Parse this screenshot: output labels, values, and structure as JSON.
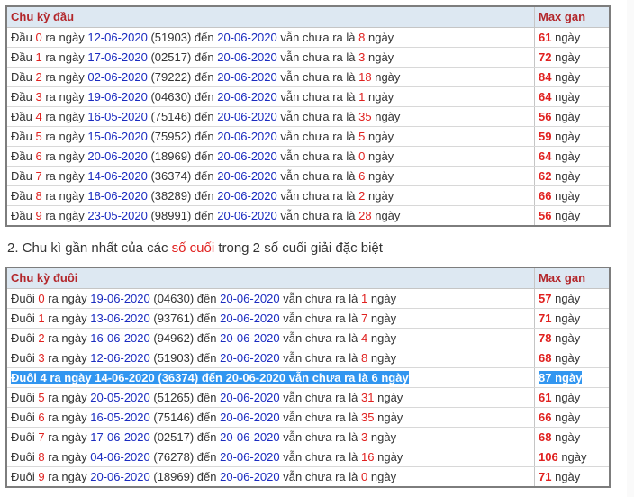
{
  "table1": {
    "col1_header": "Chu kỳ đầu",
    "col2_header": "Max gan",
    "prefix": "Đầu",
    "rows": [
      {
        "digit": "0",
        "date": "12-06-2020",
        "code": "(51903)",
        "to": "20-06-2020",
        "days": "8",
        "max": "61"
      },
      {
        "digit": "1",
        "date": "17-06-2020",
        "code": "(02517)",
        "to": "20-06-2020",
        "days": "3",
        "max": "72"
      },
      {
        "digit": "2",
        "date": "02-06-2020",
        "code": "(79222)",
        "to": "20-06-2020",
        "days": "18",
        "max": "84"
      },
      {
        "digit": "3",
        "date": "19-06-2020",
        "code": "(04630)",
        "to": "20-06-2020",
        "days": "1",
        "max": "64"
      },
      {
        "digit": "4",
        "date": "16-05-2020",
        "code": "(75146)",
        "to": "20-06-2020",
        "days": "35",
        "max": "56"
      },
      {
        "digit": "5",
        "date": "15-06-2020",
        "code": "(75952)",
        "to": "20-06-2020",
        "days": "5",
        "max": "59"
      },
      {
        "digit": "6",
        "date": "20-06-2020",
        "code": "(18969)",
        "to": "20-06-2020",
        "days": "0",
        "max": "64"
      },
      {
        "digit": "7",
        "date": "14-06-2020",
        "code": "(36374)",
        "to": "20-06-2020",
        "days": "6",
        "max": "62"
      },
      {
        "digit": "8",
        "date": "18-06-2020",
        "code": "(38289)",
        "to": "20-06-2020",
        "days": "2",
        "max": "66"
      },
      {
        "digit": "9",
        "date": "23-05-2020",
        "code": "(98991)",
        "to": "20-06-2020",
        "days": "28",
        "max": "56"
      }
    ]
  },
  "heading": {
    "before": "2. Chu kì gần nhất của các ",
    "highlight": "số cuối",
    "after": " trong 2 số cuối giải đặc biệt"
  },
  "table2": {
    "col1_header": "Chu kỳ đuôi",
    "col2_header": "Max gan",
    "prefix": "Đuôi",
    "selected_index": 4,
    "rows": [
      {
        "digit": "0",
        "date": "19-06-2020",
        "code": "(04630)",
        "to": "20-06-2020",
        "days": "1",
        "max": "57"
      },
      {
        "digit": "1",
        "date": "13-06-2020",
        "code": "(93761)",
        "to": "20-06-2020",
        "days": "7",
        "max": "71"
      },
      {
        "digit": "2",
        "date": "16-06-2020",
        "code": "(94962)",
        "to": "20-06-2020",
        "days": "4",
        "max": "78"
      },
      {
        "digit": "3",
        "date": "12-06-2020",
        "code": "(51903)",
        "to": "20-06-2020",
        "days": "8",
        "max": "68"
      },
      {
        "digit": "4",
        "date": "14-06-2020",
        "code": "(36374)",
        "to": "20-06-2020",
        "days": "6",
        "max": "87"
      },
      {
        "digit": "5",
        "date": "20-05-2020",
        "code": "(51265)",
        "to": "20-06-2020",
        "days": "31",
        "max": "61"
      },
      {
        "digit": "6",
        "date": "16-05-2020",
        "code": "(75146)",
        "to": "20-06-2020",
        "days": "35",
        "max": "66"
      },
      {
        "digit": "7",
        "date": "17-06-2020",
        "code": "(02517)",
        "to": "20-06-2020",
        "days": "3",
        "max": "68"
      },
      {
        "digit": "8",
        "date": "04-06-2020",
        "code": "(76278)",
        "to": "20-06-2020",
        "days": "16",
        "max": "106"
      },
      {
        "digit": "9",
        "date": "20-06-2020",
        "code": "(18969)",
        "to": "20-06-2020",
        "days": "0",
        "max": "71"
      }
    ]
  },
  "text": {
    "ra_ngay": "ra ngày",
    "den": "đến",
    "van_chua": "vẫn chưa ra là",
    "ngay": "ngày"
  },
  "colors": {
    "accent_red": "#e0211f",
    "date_blue": "#1a2bbf",
    "header_bg": "#dde8f2",
    "selection": "#3296f0"
  }
}
